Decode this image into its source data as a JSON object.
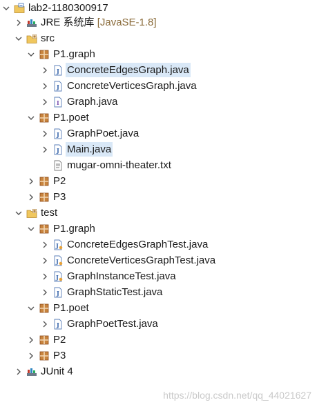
{
  "tree": {
    "project": {
      "label": "lab2-1180300917"
    },
    "jre": {
      "label": "JRE 系统库",
      "detail": "[JavaSE-1.8]"
    },
    "src": {
      "label": "src"
    },
    "src_p1graph": {
      "label": "P1.graph"
    },
    "src_p1graph_files": [
      {
        "label": "ConcreteEdgesGraph.java"
      },
      {
        "label": "ConcreteVerticesGraph.java"
      },
      {
        "label": "Graph.java"
      }
    ],
    "src_p1poet": {
      "label": "P1.poet"
    },
    "src_p1poet_files": [
      {
        "label": "GraphPoet.java"
      },
      {
        "label": "Main.java"
      },
      {
        "label": "mugar-omni-theater.txt"
      }
    ],
    "src_p2": {
      "label": "P2"
    },
    "src_p3": {
      "label": "P3"
    },
    "test": {
      "label": "test"
    },
    "test_p1graph": {
      "label": "P1.graph"
    },
    "test_p1graph_files": [
      {
        "label": "ConcreteEdgesGraphTest.java"
      },
      {
        "label": "ConcreteVerticesGraphTest.java"
      },
      {
        "label": "GraphInstanceTest.java"
      },
      {
        "label": "GraphStaticTest.java"
      }
    ],
    "test_p1poet": {
      "label": "P1.poet"
    },
    "test_p1poet_files": [
      {
        "label": "GraphPoetTest.java"
      }
    ],
    "test_p2": {
      "label": "P2"
    },
    "test_p3": {
      "label": "P3"
    },
    "junit": {
      "label": "JUnit 4"
    }
  },
  "colors": {
    "selection": "#d9e8f7",
    "package": "#8b4a1a",
    "folder": "#d9a441",
    "java_file": "#2f5fa8"
  },
  "watermark": "https://blog.csdn.net/qq_44021627"
}
